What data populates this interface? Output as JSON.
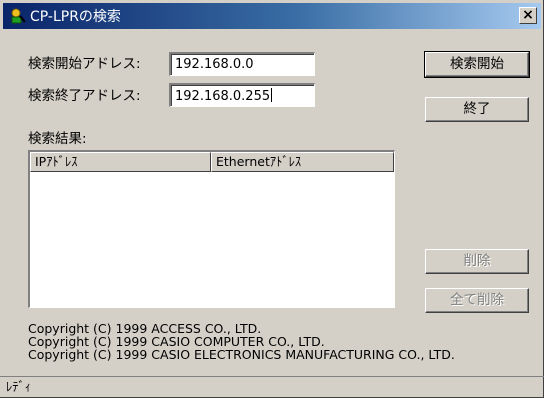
{
  "window": {
    "title": "CP-LPRの検索",
    "close_label": "×"
  },
  "form": {
    "start_label": "検索開始アドレス:",
    "start_value": "192.168.0.0",
    "end_label": "検索終了アドレス:",
    "end_value": "192.168.0.255",
    "results_label": "検索結果:"
  },
  "buttons": {
    "search_start": "検索開始",
    "exit": "終了",
    "delete": "削除",
    "delete_all": "全て削除"
  },
  "results_table": {
    "columns": [
      "IPｱﾄﾞﾚｽ",
      "Ethernetｱﾄﾞﾚｽ"
    ],
    "rows": []
  },
  "copyright": [
    "Copyright (C) 1999 ACCESS CO., LTD.",
    "Copyright (C) 1999 CASIO COMPUTER CO., LTD.",
    "Copyright (C) 1999 CASIO ELECTRONICS MANUFACTURING CO., LTD."
  ],
  "status": "ﾚﾃﾞｨ"
}
